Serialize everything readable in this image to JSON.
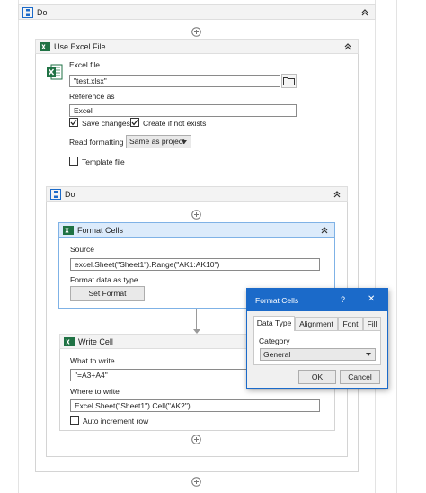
{
  "outer_do": {
    "title": "Do"
  },
  "excel_scope": {
    "title": "Use Excel File",
    "excel_file_label": "Excel file",
    "excel_file_value": "\"test.xlsx\"",
    "reference_label": "Reference as",
    "reference_value": "Excel",
    "save_changes_label": "Save changes",
    "save_changes_checked": true,
    "create_if_not_exists_label": "Create if not exists",
    "create_if_not_exists_checked": true,
    "read_formatting_label": "Read formatting",
    "read_formatting_value": "Same as project",
    "template_file_label": "Template file",
    "template_file_checked": false
  },
  "inner_do": {
    "title": "Do"
  },
  "format_cells": {
    "title": "Format Cells",
    "source_label": "Source",
    "source_value": "excel.Sheet(\"Sheet1\").Range(\"AK1:AK10\")",
    "format_type_label": "Format data as type",
    "set_format_button": "Set Format"
  },
  "write_cell": {
    "title": "Write Cell",
    "what_label": "What to write",
    "what_value": "\"=A3+A4\"",
    "where_label": "Where to write",
    "where_value": "Excel.Sheet(\"Sheet1\").Cell(\"AK2\")",
    "auto_increment_label": "Auto increment row",
    "auto_increment_checked": false
  },
  "dialog": {
    "title": "Format Cells",
    "help": "?",
    "close": "✕",
    "tabs": [
      "Data Type",
      "Alignment",
      "Font",
      "Fill"
    ],
    "active_tab": "Data Type",
    "category_label": "Category",
    "category_value": "General",
    "ok_button": "OK",
    "cancel_button": "Cancel"
  },
  "colors": {
    "accent": "#1b6ac9",
    "header_bg": "#f3f3f3",
    "selected_header_bg": "#dcebfb",
    "excel_green": "#1f7244"
  }
}
